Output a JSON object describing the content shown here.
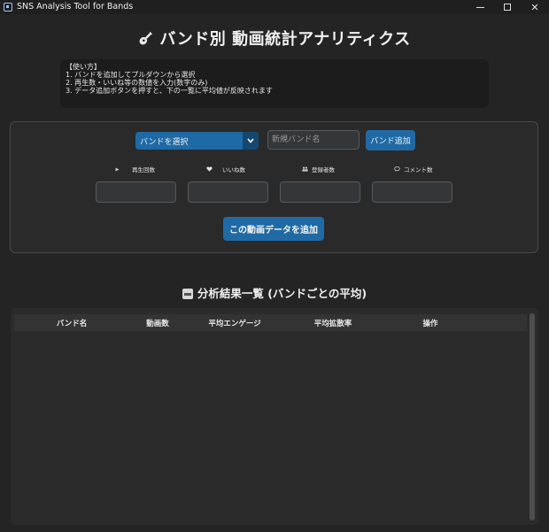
{
  "window": {
    "title": "SNS Analysis Tool for Bands"
  },
  "header": {
    "title": "バンド別 動画統計アナリティクス",
    "icon": "guitar-icon"
  },
  "instructions": {
    "lines": [
      "【使い方】",
      "1. バンドを追加してプルダウンから選択",
      "2. 再生数・いいね等の数値を入力(数字のみ)",
      "3. データ追加ボタンを押すと、下の一覧に平均値が反映されます"
    ]
  },
  "form": {
    "band_select": {
      "selected": "バンドを選択"
    },
    "new_band": {
      "placeholder": "新規バンド名",
      "value": ""
    },
    "add_band_label": "バンド追加",
    "metrics": [
      {
        "icon": "play-icon",
        "label": "再生回数",
        "value": ""
      },
      {
        "icon": "heart-icon",
        "label": "いいね数",
        "value": ""
      },
      {
        "icon": "people-icon",
        "label": "登録者数",
        "value": ""
      },
      {
        "icon": "comment-icon",
        "label": "コメント数",
        "value": ""
      }
    ],
    "add_video_label": "この動画データを追加"
  },
  "results": {
    "title": "分析結果一覧 (バンドごとの平均)",
    "icon": "inbox-tray-icon",
    "columns": [
      "バンド名",
      "動画数",
      "平均エンゲージ",
      "平均拡散率",
      "操作"
    ],
    "rows": []
  },
  "colors": {
    "accent": "#1f6aa5",
    "accent_dark": "#144870",
    "background": "#242424",
    "panel": "#2a2a2a",
    "input_bg": "#343638"
  }
}
